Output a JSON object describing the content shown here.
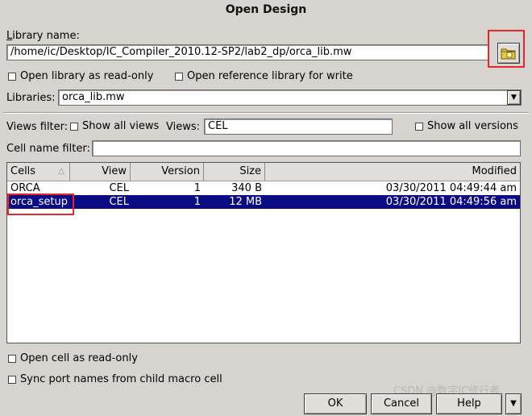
{
  "window": {
    "title": "Open Design"
  },
  "library": {
    "label": "Library name:",
    "path": "/home/ic/Desktop/IC_Compiler_2010.12-SP2/lab2_dp/orca_lib.mw"
  },
  "options": {
    "open_readonly": "Open library as read-only",
    "open_reference": "Open reference library for write"
  },
  "libraries": {
    "label": "Libraries:",
    "selected": "orca_lib.mw"
  },
  "filters": {
    "views_filter_label": "Views filter:",
    "show_all_views": "Show all views",
    "views_label": "Views:",
    "views_value": "CEL",
    "show_all_versions": "Show all versions",
    "cell_name_filter_label": "Cell name filter:",
    "cell_name_filter_value": ""
  },
  "table": {
    "columns": [
      "Cells",
      "View",
      "Version",
      "Size",
      "Modified"
    ],
    "rows": [
      {
        "cell": "ORCA",
        "view": "CEL",
        "version": "1",
        "size": "340 B",
        "modified": "03/30/2011 04:49:44 am"
      },
      {
        "cell": "orca_setup",
        "view": "CEL",
        "version": "1",
        "size": "12 MB",
        "modified": "03/30/2011 04:49:56 am"
      }
    ]
  },
  "bottom_options": {
    "open_cell_readonly": "Open cell as read-only",
    "sync_port_names": "Sync port names from child macro cell"
  },
  "buttons": {
    "ok": "OK",
    "cancel": "Cancel",
    "help": "Help"
  },
  "watermark": "CSDN @数字IC修行者",
  "colors": {
    "selection": "#0b0b83",
    "highlight": "#e8262b",
    "background": "#d7d4d0"
  }
}
